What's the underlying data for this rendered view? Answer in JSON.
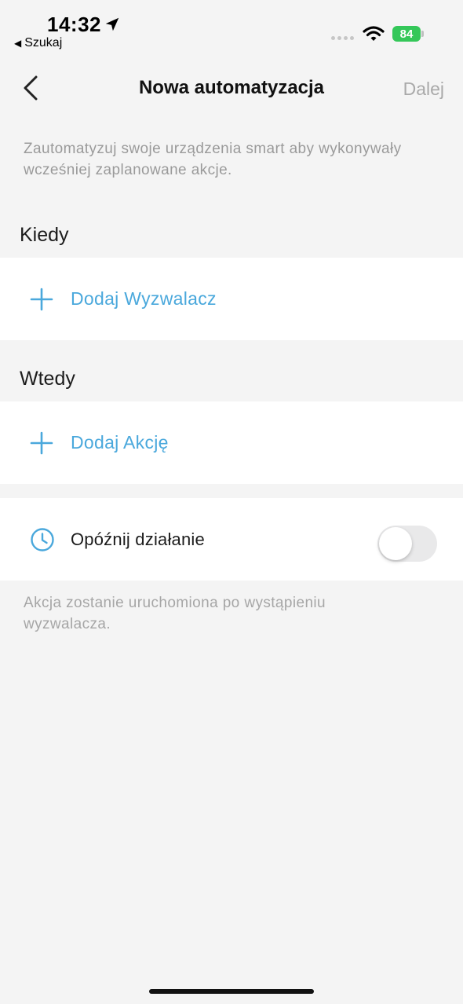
{
  "status_bar": {
    "time": "14:32",
    "back_app_label": "Szukaj",
    "battery_level": "84",
    "battery_color": "#34c759"
  },
  "nav": {
    "title": "Nowa automatyzacja",
    "next_label": "Dalej",
    "back_icon": "chevron-left-icon"
  },
  "intro_text": "Zautomatyzuj swoje urządzenia smart aby wykonywały wcześniej zaplanowane akcje.",
  "when_section": {
    "label": "Kiedy",
    "add_label": "Dodaj Wyzwalacz",
    "icon": "plus-icon"
  },
  "then_section": {
    "label": "Wtedy",
    "add_label": "Dodaj Akcję",
    "icon": "plus-icon"
  },
  "delay": {
    "label": "Opóźnij działanie",
    "icon": "clock-icon",
    "enabled": false
  },
  "footnote": "Akcja zostanie uruchomiona po wystąpieniu wyzwalacza.",
  "colors": {
    "accent": "#4aa8dc",
    "background": "#f4f4f4",
    "muted_text": "#9a9a9a"
  }
}
